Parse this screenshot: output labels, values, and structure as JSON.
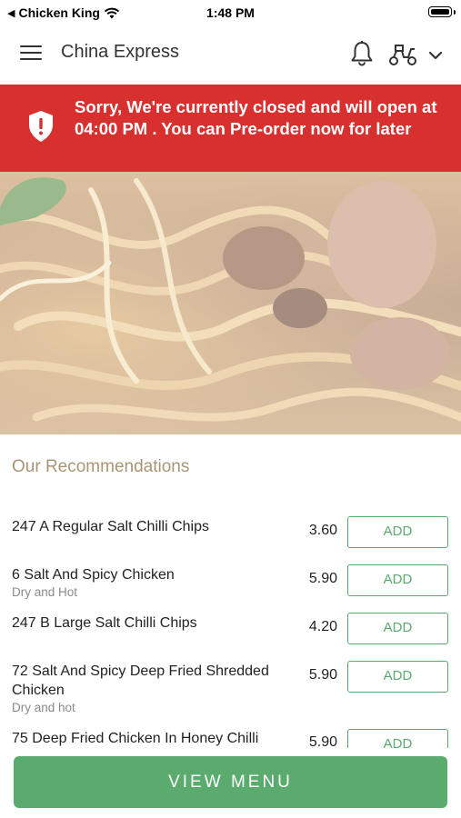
{
  "status_bar": {
    "back_app": "Chicken King",
    "time": "1:48 PM"
  },
  "header": {
    "title": "China Express",
    "icons": [
      "menu-icon",
      "bell-icon",
      "delivery-scooter-icon",
      "chevron-down-icon"
    ]
  },
  "banner": {
    "message": "Sorry, We're currently closed and will open at 04:00 PM . You can Pre-order now for later",
    "color": "#d8302e",
    "icon": "shield-alert-icon"
  },
  "recommendations": {
    "title": "Our Recommendations",
    "items": [
      {
        "name": "247 A Regular Salt Chilli Chips",
        "desc": "",
        "price": "3.60",
        "button": "ADD"
      },
      {
        "name": "6 Salt And Spicy Chicken",
        "desc": "Dry and Hot",
        "price": "5.90",
        "button": "ADD"
      },
      {
        "name": "247 B Large Salt Chilli Chips",
        "desc": "",
        "price": "4.20",
        "button": "ADD"
      },
      {
        "name": "72 Salt And Spicy Deep Fried Shredded Chicken",
        "desc": "Dry and hot",
        "price": "5.90",
        "button": "ADD"
      },
      {
        "name": "75 Deep Fried Chicken In Honey Chilli",
        "desc": "",
        "price": "5.90",
        "button": "ADD"
      }
    ]
  },
  "footer": {
    "view_menu_label": "VIEW MENU",
    "accent": "#5bab6f"
  }
}
